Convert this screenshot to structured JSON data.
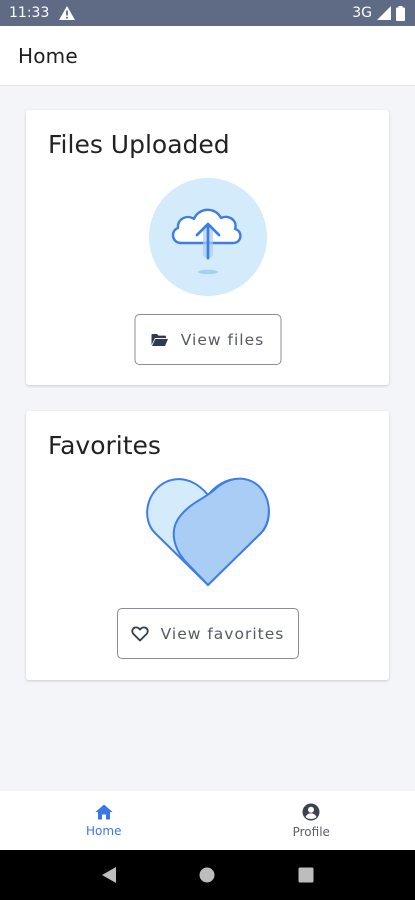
{
  "status_bar": {
    "time": "11:33",
    "network": "3G",
    "alert_icon": "warning-icon",
    "signal_icon": "signal-icon",
    "battery_icon": "battery-icon"
  },
  "app_bar": {
    "title": "Home"
  },
  "cards": {
    "files": {
      "title": "Files Uploaded",
      "illustration": "cloud-upload-icon",
      "button_label": "View files",
      "button_icon": "folder-icon"
    },
    "favorites": {
      "title": "Favorites",
      "illustration": "heart-icon",
      "button_label": "View favorites",
      "button_icon": "heart-outline-icon"
    }
  },
  "bottom_nav": {
    "items": [
      {
        "label": "Home",
        "icon": "home-icon",
        "active": true
      },
      {
        "label": "Profile",
        "icon": "account-circle-icon",
        "active": false
      }
    ]
  },
  "system_nav": {
    "back": "back-icon",
    "home": "home-circle-icon",
    "recents": "recents-icon"
  },
  "colors": {
    "accent": "#3b76e8",
    "status_bar": "#5f6b85",
    "background": "#f4f5f9",
    "illustration_light": "#d4ebfb",
    "illustration_stroke": "#3f7de6"
  }
}
